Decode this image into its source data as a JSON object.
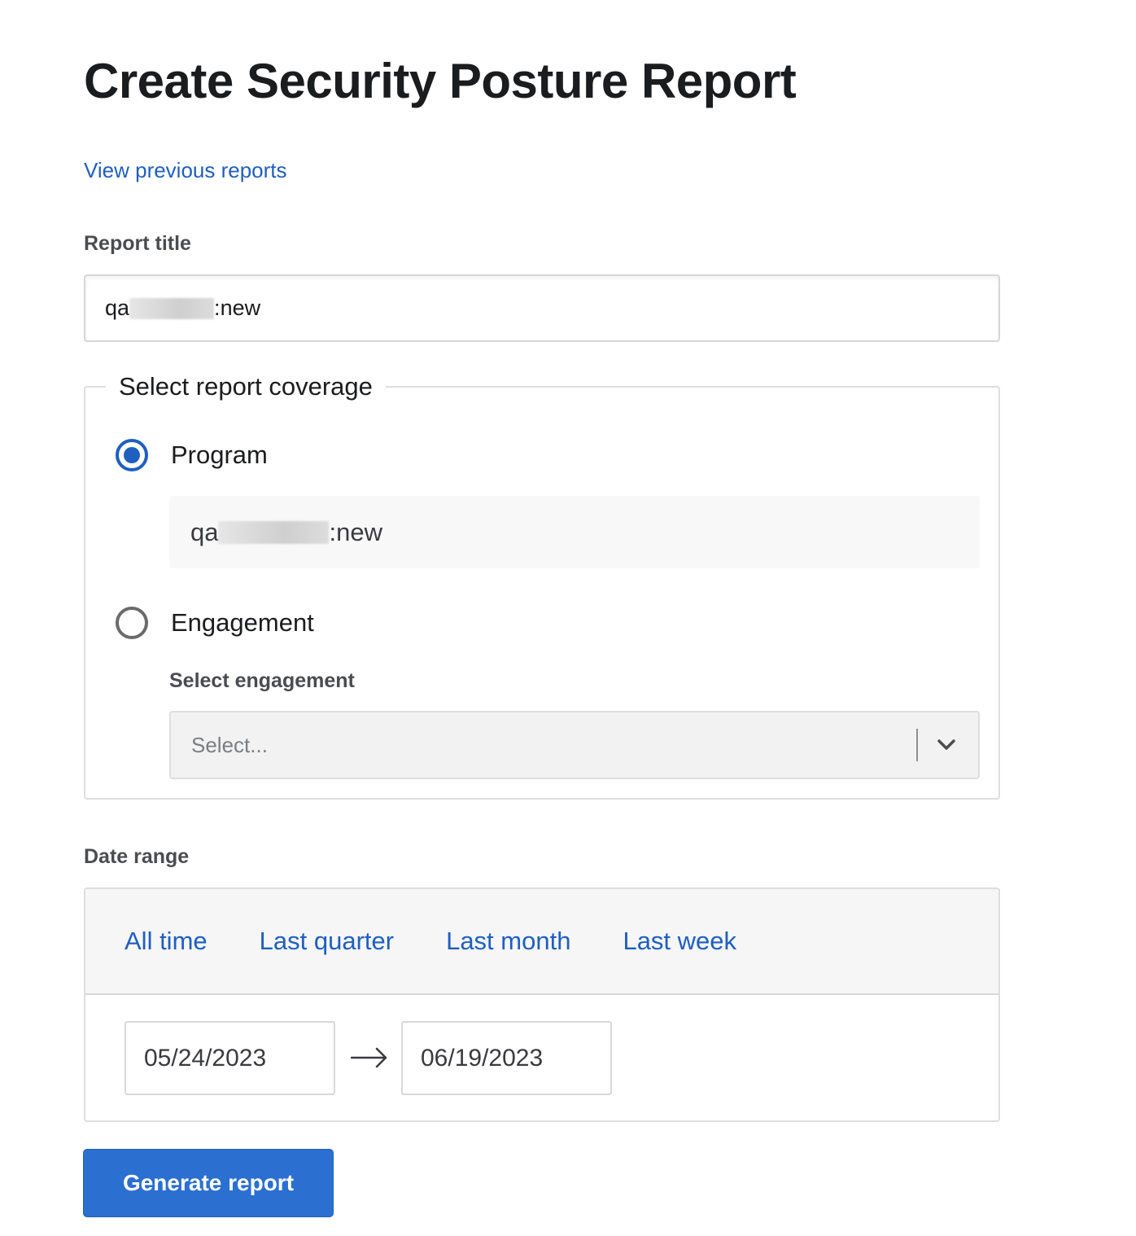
{
  "page": {
    "title": "Create Security Posture Report",
    "previous_reports_link": "View previous reports"
  },
  "report_title": {
    "label": "Report title",
    "value_prefix": "qa",
    "value_redacted": true,
    "value_suffix": "new"
  },
  "coverage": {
    "legend": "Select report coverage",
    "options": [
      {
        "label": "Program",
        "checked": true
      },
      {
        "label": "Engagement",
        "checked": false
      }
    ],
    "program_value_prefix": "qa",
    "program_value_redacted": true,
    "program_value_suffix": "new",
    "engagement_select": {
      "label": "Select engagement",
      "placeholder": "Select..."
    }
  },
  "date_range": {
    "label": "Date range",
    "presets": [
      "All time",
      "Last quarter",
      "Last month",
      "Last week"
    ],
    "start_date": "05/24/2023",
    "end_date": "06/19/2023"
  },
  "actions": {
    "generate_label": "Generate report"
  },
  "colors": {
    "accent": "#1f5fbf",
    "button": "#2b6fd1"
  }
}
